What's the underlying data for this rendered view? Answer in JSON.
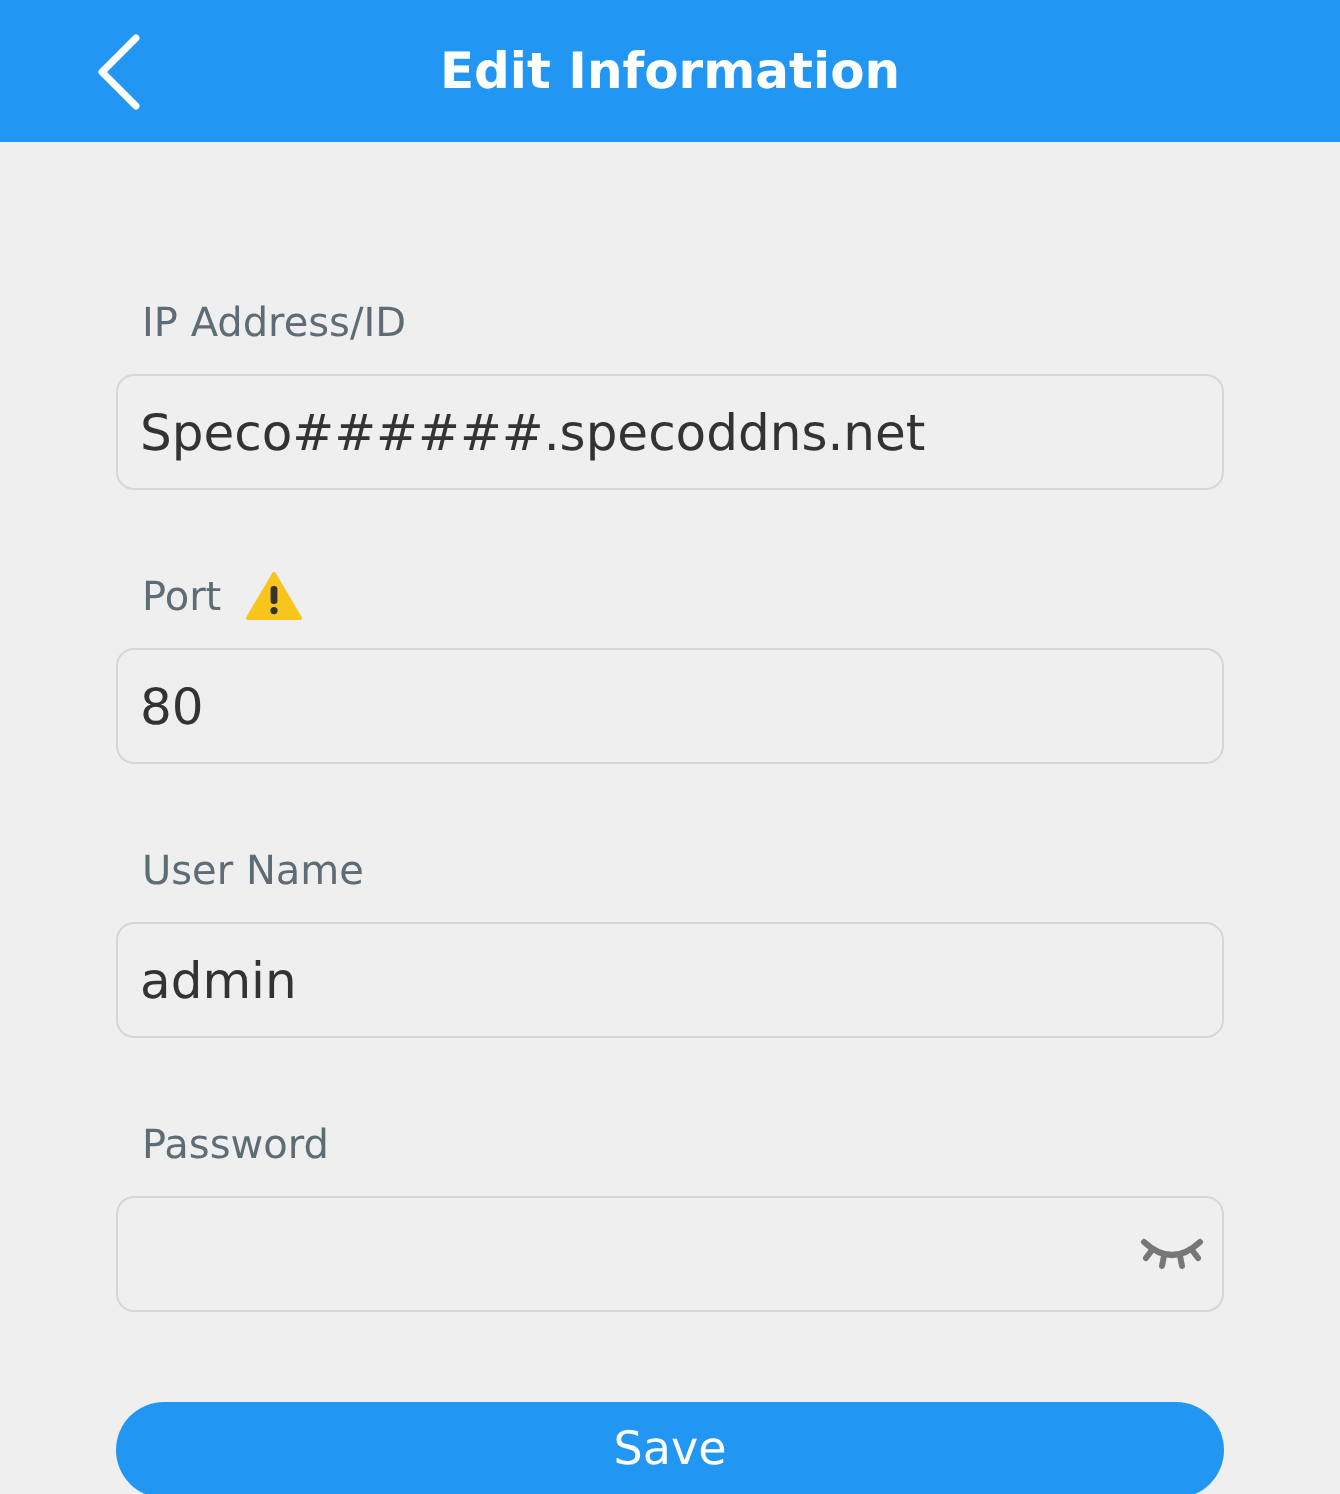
{
  "header": {
    "title": "Edit Information"
  },
  "fields": [
    {
      "label": "IP Address/ID",
      "value": "Speco######.specoddns.net",
      "kind": "text",
      "warning": false
    },
    {
      "label": "Port",
      "value": "80",
      "kind": "text",
      "warning": true
    },
    {
      "label": "User Name",
      "value": "admin",
      "kind": "text",
      "warning": false
    },
    {
      "label": "Password",
      "kind": "password",
      "warning": false
    }
  ],
  "save_button": "Save"
}
